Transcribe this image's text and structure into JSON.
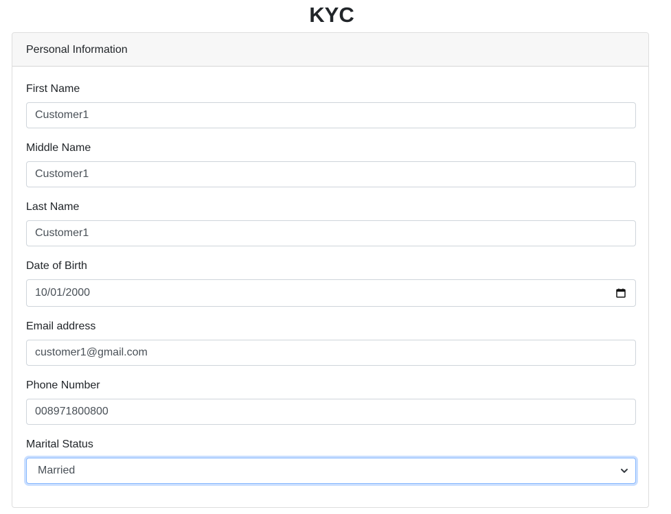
{
  "page": {
    "title": "KYC"
  },
  "card": {
    "header": "Personal Information",
    "fields": {
      "first_name": {
        "label": "First Name",
        "value": "Customer1"
      },
      "middle_name": {
        "label": "Middle Name",
        "value": "Customer1"
      },
      "last_name": {
        "label": "Last Name",
        "value": "Customer1"
      },
      "date_of_birth": {
        "label": "Date of Birth",
        "value": "10/01/2000"
      },
      "email": {
        "label": "Email address",
        "value": "customer1@gmail.com"
      },
      "phone": {
        "label": "Phone Number",
        "value": "008971800800"
      },
      "marital_status": {
        "label": "Marital Status",
        "value": "Married"
      }
    }
  },
  "icons": {
    "date_picker": "calendar-icon",
    "select_arrow": "chevron-down-icon"
  },
  "colors": {
    "text": "#212529",
    "input_text": "#495057",
    "input_border": "#ced4da",
    "focus_border": "#86b7fe",
    "header_bg": "#f7f7f7"
  }
}
